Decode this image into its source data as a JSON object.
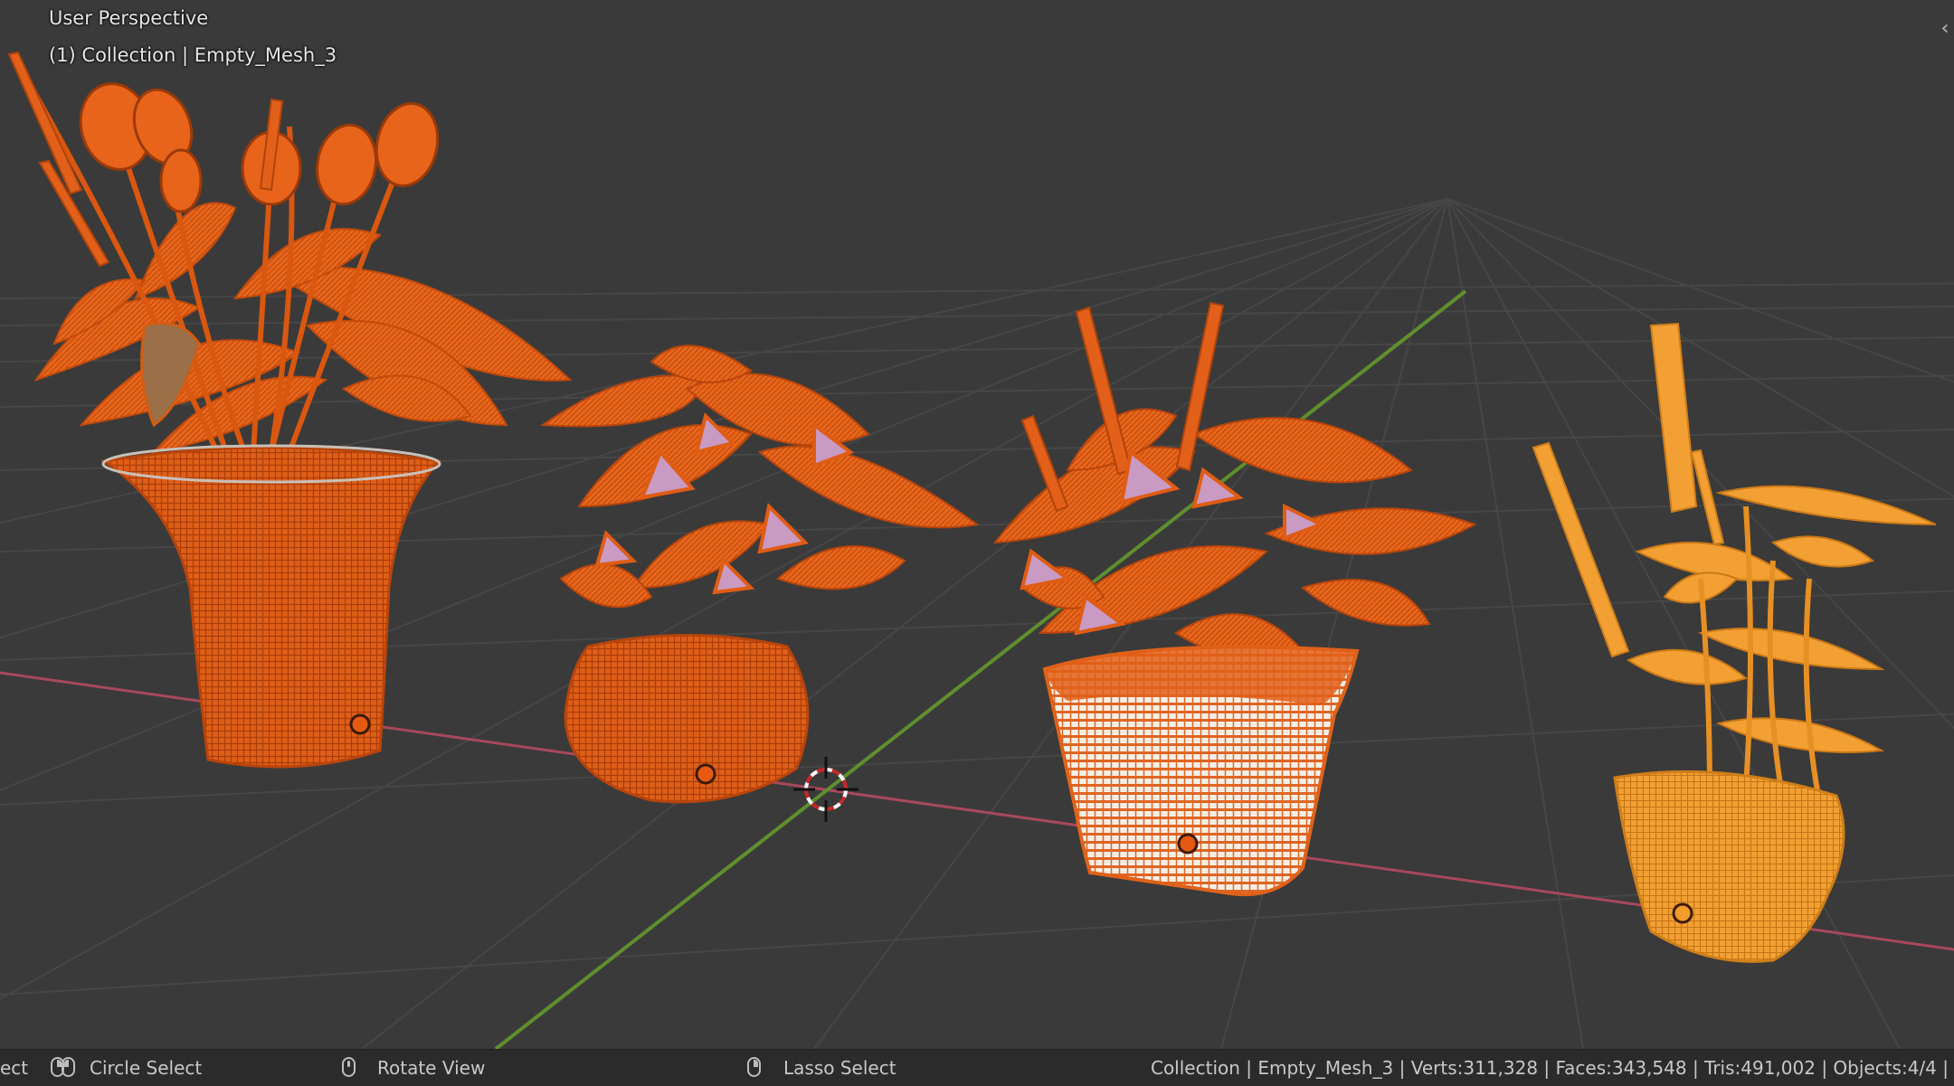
{
  "viewport": {
    "perspective_label": "User Perspective",
    "collection_label": "(1) Collection | Empty_Mesh_3",
    "colors": {
      "background": "#3a3a3a",
      "grid": "#464646",
      "x_axis": "#a8485a",
      "y_axis": "#5f8f2e",
      "selected_active": "#f0801e",
      "selected": "#e2621a",
      "basket_light": "#f5efe4",
      "petal": "#c99ac2"
    },
    "objects": [
      {
        "name": "tulip-bouquet-basket"
      },
      {
        "name": "round-flower-basket"
      },
      {
        "name": "square-flower-basket"
      },
      {
        "name": "lavender-basket-active"
      }
    ]
  },
  "statusbar": {
    "select_partial": "ect",
    "circle_select": "Circle Select",
    "rotate_view": "Rotate View",
    "lasso_select": "Lasso Select",
    "scene_stats": "Collection | Empty_Mesh_3 | Verts:311,328 | Faces:343,548 | Tris:491,002 | Objects:4/4 |"
  }
}
